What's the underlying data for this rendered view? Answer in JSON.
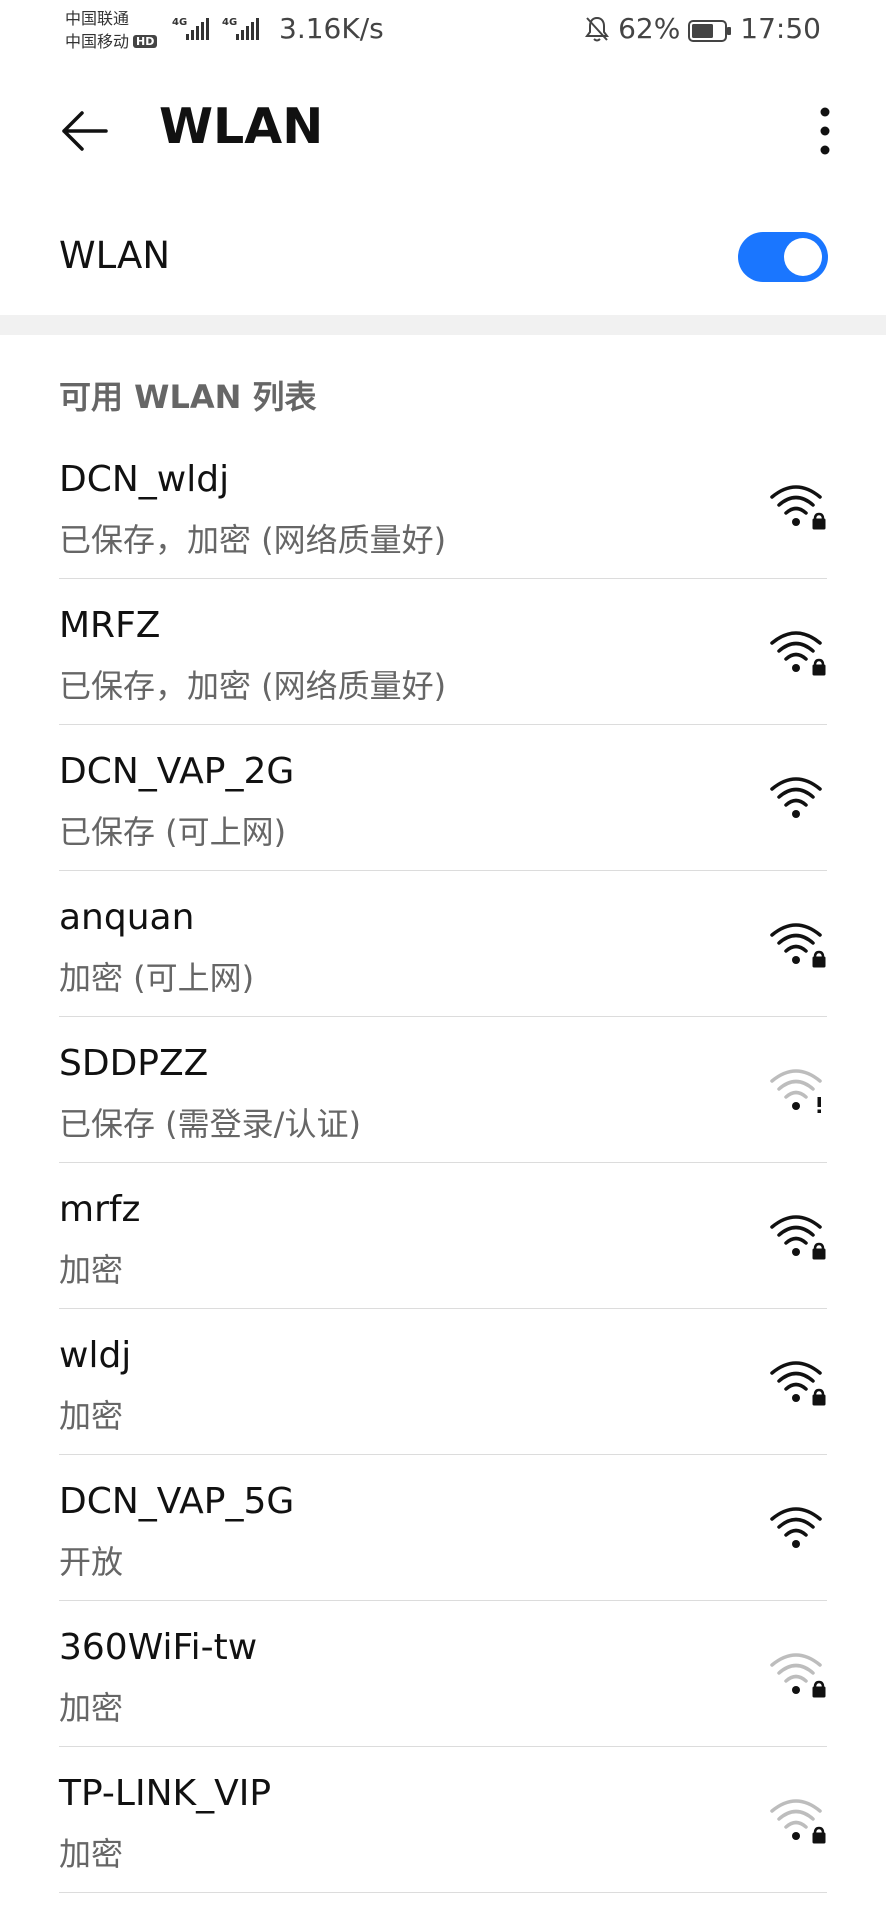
{
  "status_bar": {
    "carrier_1": "中国联通",
    "carrier_2": "中国移动",
    "hd_badge": "HD",
    "sim1_network": "4G",
    "sim2_network": "4G",
    "network_speed": "3.16K/s",
    "battery": "62%",
    "time": "17:50"
  },
  "header": {
    "title": "WLAN"
  },
  "wlan_toggle": {
    "label": "WLAN",
    "enabled": true,
    "accent_color": "#1a76ff"
  },
  "available_list": {
    "header": "可用 WLAN 列表",
    "networks": [
      {
        "ssid": "DCN_wldj",
        "status": "已保存，加密 (网络质量好)",
        "icon": "wifi-locked-icon",
        "strength": "strong"
      },
      {
        "ssid": "MRFZ",
        "status": "已保存，加密 (网络质量好)",
        "icon": "wifi-locked-icon",
        "strength": "strong"
      },
      {
        "ssid": "DCN_VAP_2G",
        "status": "已保存 (可上网)",
        "icon": "wifi-icon",
        "strength": "strong"
      },
      {
        "ssid": "anquan",
        "status": "加密 (可上网)",
        "icon": "wifi-locked-icon",
        "strength": "strong"
      },
      {
        "ssid": "SDDPZZ",
        "status": "已保存 (需登录/认证)",
        "icon": "wifi-alert-icon",
        "strength": "weak"
      },
      {
        "ssid": "mrfz",
        "status": "加密",
        "icon": "wifi-locked-icon",
        "strength": "strong"
      },
      {
        "ssid": "wldj",
        "status": "加密",
        "icon": "wifi-locked-icon",
        "strength": "strong"
      },
      {
        "ssid": "DCN_VAP_5G",
        "status": "开放",
        "icon": "wifi-icon",
        "strength": "strong"
      },
      {
        "ssid": "360WiFi-tw",
        "status": "加密",
        "icon": "wifi-locked-icon",
        "strength": "weak"
      },
      {
        "ssid": "TP-LINK_VIP",
        "status": "加密",
        "icon": "wifi-locked-icon",
        "strength": "weak"
      }
    ]
  }
}
